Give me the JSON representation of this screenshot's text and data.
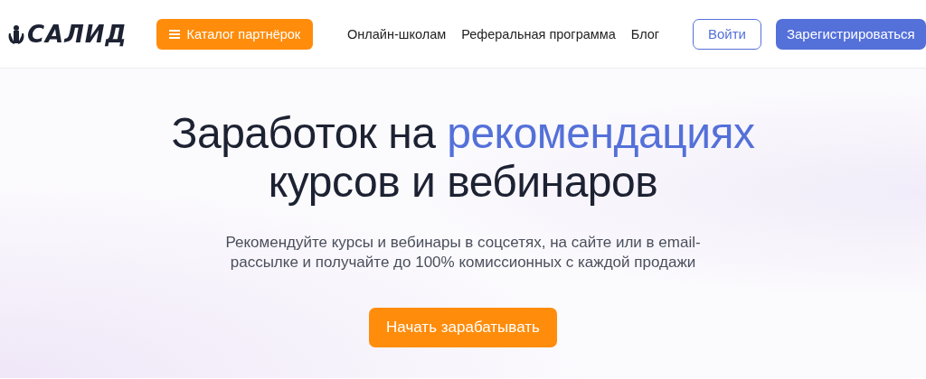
{
  "header": {
    "logo": "САЛИД",
    "catalog_button": "Каталог партнёрок",
    "nav": [
      "Онлайн-школам",
      "Реферальная программа",
      "Блог"
    ],
    "login_button": "Войти",
    "register_button": "Зарегистрироваться"
  },
  "hero": {
    "title": {
      "before": "Заработок на ",
      "highlight": "рекомендациях",
      "after": " курсов и вебинаров"
    },
    "subtitle": "Рекомендуйте курсы и вебинары в соцсетях, на сайте или в email-рассылке и получайте до 100% комиссионных с каждой продажи",
    "cta_button": "Начать зарабатывать"
  }
}
